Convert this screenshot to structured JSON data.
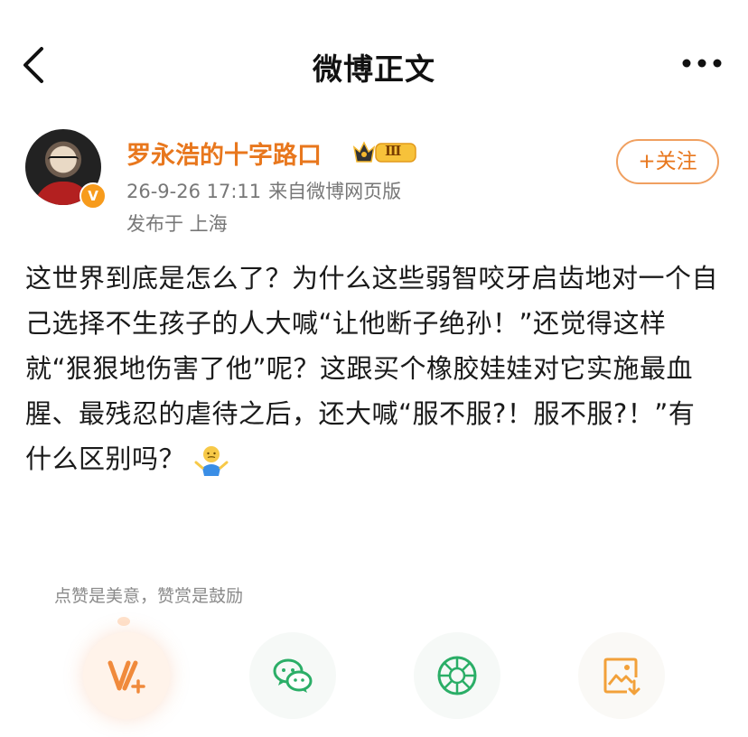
{
  "header": {
    "title": "微博正文",
    "back_icon": "chevron-left-icon",
    "more_icon": "more-dots-icon"
  },
  "author": {
    "name": "罗永浩的十字路口",
    "avatar_icon": "avatar",
    "verified_badge": "V",
    "member_badge_level": "Ⅲ",
    "time": "26-9-26 17:11",
    "source": "来自微博网页版",
    "location": "发布于 上海",
    "follow_label": "+关注",
    "accent_color": "#e8771d"
  },
  "post": {
    "text": "这世界到底是怎么了？为什么这些弱智咬牙启齿地对一个自己选择不生孩子的人大喊“让他断子绝孙！”还觉得这样就“狠狠地伤害了他”呢？这跟买个橡胶娃娃对它实施最血腥、最残忍的虐待之后，还大喊“服不服?！服不服?！”有什么区别吗？",
    "emoji": "shrug-emoji"
  },
  "reward": {
    "hint": "点赞是美意，赞赏是鼓励",
    "actions": [
      {
        "name": "vplus-reward-button",
        "icon": "vplus-icon",
        "color": "#f08a3c"
      },
      {
        "name": "wechat-share-button",
        "icon": "wechat-icon",
        "color": "#2bae67"
      },
      {
        "name": "moments-share-button",
        "icon": "moments-icon",
        "color": "#2bae67"
      },
      {
        "name": "save-image-button",
        "icon": "save-image-icon",
        "color": "#f2a13a"
      }
    ]
  }
}
